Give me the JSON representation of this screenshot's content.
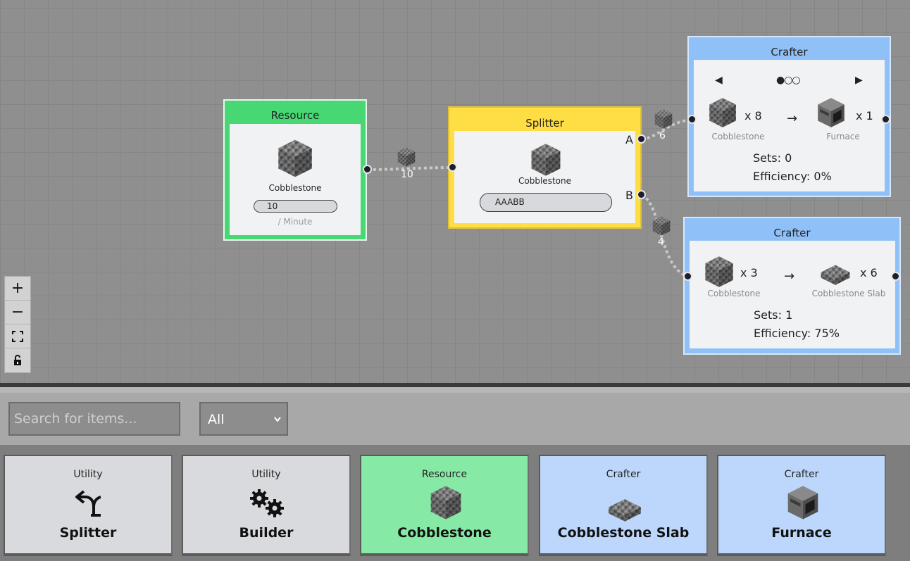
{
  "canvas": {
    "resource_node": {
      "title": "Resource",
      "item": "Cobblestone",
      "rate": "10",
      "rate_unit": "/ Minute",
      "color": "#47d873"
    },
    "splitter_node": {
      "title": "Splitter",
      "item": "Cobblestone",
      "pattern": "AAABB",
      "port_a": "A",
      "port_b": "B",
      "color": "#ffdd44"
    },
    "crafter_1": {
      "title": "Crafter",
      "input_qty": "x 8",
      "input_item": "Cobblestone",
      "arrow": "→",
      "output_qty": "x 1",
      "output_item": "Furnace",
      "sets": "Sets: 0",
      "efficiency": "Efficiency: 0%",
      "pager_prev": "◀",
      "pager_dots": "●○○",
      "pager_next": "▶",
      "color": "#90c0f8"
    },
    "crafter_2": {
      "title": "Crafter",
      "input_qty": "x 3",
      "input_item": "Cobblestone",
      "arrow": "→",
      "output_qty": "x 6",
      "output_item": "Cobblestone Slab",
      "sets": "Sets: 1",
      "efficiency": "Efficiency: 75%",
      "color": "#90c0f8"
    },
    "edges": [
      {
        "label": "10"
      },
      {
        "label": "6"
      },
      {
        "label": "4"
      }
    ],
    "zoom_controls": [
      "+",
      "−",
      "⛶",
      "🔒"
    ]
  },
  "toolbar": {
    "search_placeholder": "Search for items...",
    "filter_value": "All"
  },
  "palette": [
    {
      "category": "Utility",
      "name": "Splitter",
      "icon": "split-arrow-icon",
      "color": "#d9dadd"
    },
    {
      "category": "Utility",
      "name": "Builder",
      "icon": "gears-icon",
      "color": "#d9dadd"
    },
    {
      "category": "Resource",
      "name": "Cobblestone",
      "icon": "cobblestone-icon",
      "color": "#86eaa6"
    },
    {
      "category": "Crafter",
      "name": "Cobblestone Slab",
      "icon": "cobblestone-slab-icon",
      "color": "#bcd7fb"
    },
    {
      "category": "Crafter",
      "name": "Furnace",
      "icon": "furnace-icon",
      "color": "#bcd7fb"
    }
  ]
}
